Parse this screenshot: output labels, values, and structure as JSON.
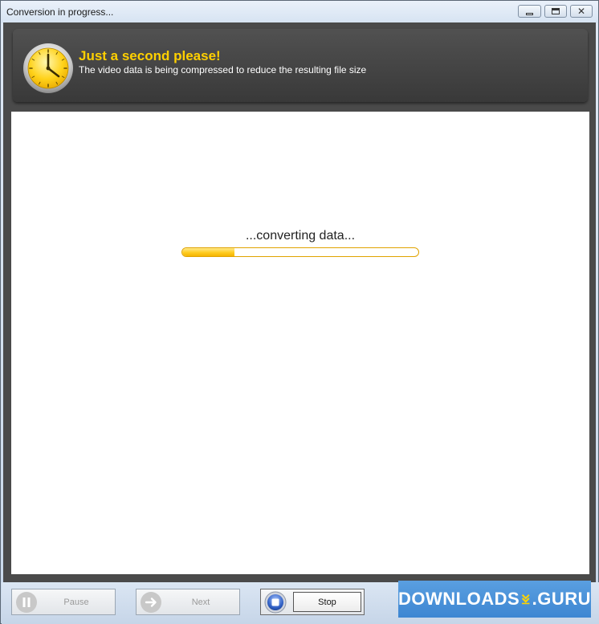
{
  "window": {
    "title": "Conversion in progress..."
  },
  "header": {
    "title": "Just a second please!",
    "subtitle": "The video data is being compressed to reduce the resulting file size",
    "icon": "clock-icon"
  },
  "content": {
    "status": "...converting data...",
    "progress_fraction": 0.22
  },
  "footer": {
    "pause_label": "Pause",
    "next_label": "Next",
    "stop_label": "Stop"
  },
  "watermark": {
    "left": "DOWNLOADS",
    "right": ".GURU"
  },
  "colors": {
    "accent": "#ffd000",
    "progress": "#ffcc20"
  }
}
